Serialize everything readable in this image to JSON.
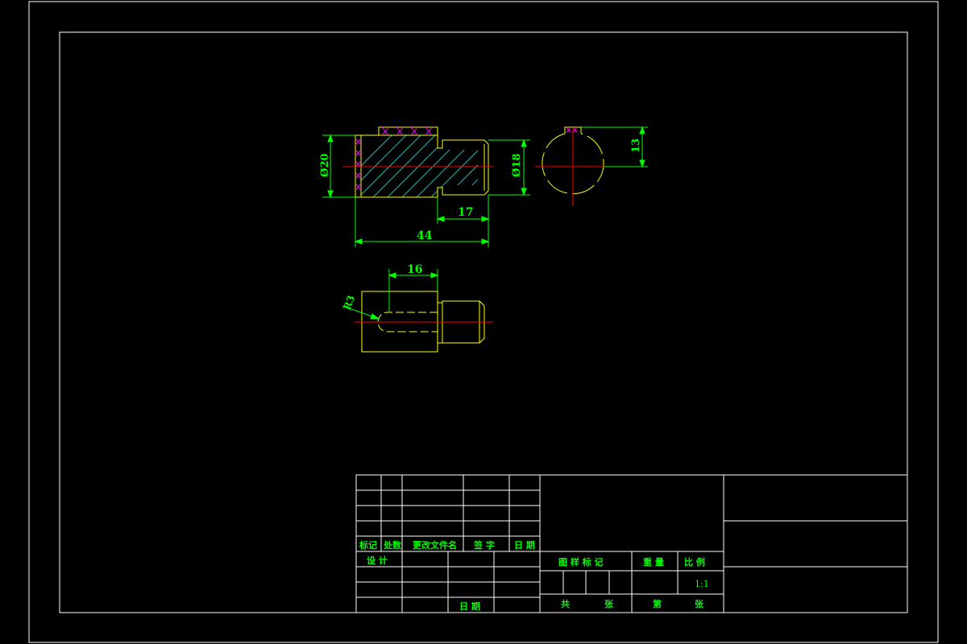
{
  "dimensions": {
    "front_diameter": "Ø20",
    "neck_diameter": "Ø18",
    "length_overall": "44",
    "length_neck": "17",
    "key_depth": "13",
    "slot_length": "16",
    "slot_radius": "R3"
  },
  "title_block": {
    "rev_mark": "标记",
    "rev_count": "处数",
    "rev_doc": "更改文件名",
    "rev_sign": "签  字",
    "rev_date": "日  期",
    "design": "设  计",
    "date": "日  期",
    "drawing_mark": "图  样  标  记",
    "weight": "重  量",
    "scale_label": "比  例",
    "scale_value": "1:1",
    "total": "共",
    "sheets_1": "张",
    "sheet_no": "第",
    "sheets_2": "张"
  },
  "colors": {
    "background": "#000000",
    "border": "#ffffff",
    "outline": "#ffff00",
    "dimension": "#00ff00",
    "hatch": "#00c8c8",
    "centerline": "#ff0000",
    "knurl": "#ff00ff"
  }
}
